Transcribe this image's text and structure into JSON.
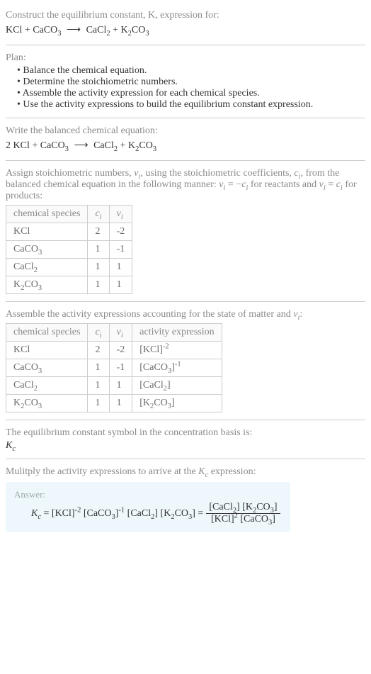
{
  "header": {
    "prompt": "Construct the equilibrium constant, K, expression for:",
    "equation_html": "KCl + CaCO<sub>3</sub> <span class='arrow'>⟶</span> CaCl<sub>2</sub> + K<sub>2</sub>CO<sub>3</sub>"
  },
  "plan": {
    "label": "Plan:",
    "items": [
      "Balance the chemical equation.",
      "Determine the stoichiometric numbers.",
      "Assemble the activity expression for each chemical species.",
      "Use the activity expressions to build the equilibrium constant expression."
    ]
  },
  "balanced": {
    "prompt": "Write the balanced chemical equation:",
    "equation_html": "2 KCl + CaCO<sub>3</sub> <span class='arrow'>⟶</span> CaCl<sub>2</sub> + K<sub>2</sub>CO<sub>3</sub>"
  },
  "stoich": {
    "intro_html": "Assign stoichiometric numbers, <span class='italic'>ν<sub>i</sub></span>, using the stoichiometric coefficients, <span class='italic'>c<sub>i</sub></span>, from the balanced chemical equation in the following manner: <span class='italic'>ν<sub>i</sub></span> = −<span class='italic'>c<sub>i</sub></span> for reactants and <span class='italic'>ν<sub>i</sub></span> = <span class='italic'>c<sub>i</sub></span> for products:",
    "headers": {
      "species": "chemical species",
      "ci_html": "<span class='italic'>c<sub>i</sub></span>",
      "vi_html": "<span class='italic'>ν<sub>i</sub></span>"
    },
    "rows": [
      {
        "species_html": "KCl",
        "ci": "2",
        "vi": "-2"
      },
      {
        "species_html": "CaCO<sub>3</sub>",
        "ci": "1",
        "vi": "-1"
      },
      {
        "species_html": "CaCl<sub>2</sub>",
        "ci": "1",
        "vi": "1"
      },
      {
        "species_html": "K<sub>2</sub>CO<sub>3</sub>",
        "ci": "1",
        "vi": "1"
      }
    ]
  },
  "activity": {
    "intro_html": "Assemble the activity expressions accounting for the state of matter and <span class='italic'>ν<sub>i</sub></span>:",
    "headers": {
      "species": "chemical species",
      "ci_html": "<span class='italic'>c<sub>i</sub></span>",
      "vi_html": "<span class='italic'>ν<sub>i</sub></span>",
      "activity": "activity expression"
    },
    "rows": [
      {
        "species_html": "KCl",
        "ci": "2",
        "vi": "-2",
        "activity_html": "[KCl]<sup>-2</sup>"
      },
      {
        "species_html": "CaCO<sub>3</sub>",
        "ci": "1",
        "vi": "-1",
        "activity_html": "[CaCO<sub>3</sub>]<sup>-1</sup>"
      },
      {
        "species_html": "CaCl<sub>2</sub>",
        "ci": "1",
        "vi": "1",
        "activity_html": "[CaCl<sub>2</sub>]"
      },
      {
        "species_html": "K<sub>2</sub>CO<sub>3</sub>",
        "ci": "1",
        "vi": "1",
        "activity_html": "[K<sub>2</sub>CO<sub>3</sub>]"
      }
    ]
  },
  "kc_symbol": {
    "line1": "The equilibrium constant symbol in the concentration basis is:",
    "line2_html": "<span class='italic'>K<sub>c</sub></span>"
  },
  "multiply": {
    "prompt_html": "Mulitply the activity expressions to arrive at the <span class='italic'>K<sub>c</sub></span> expression:"
  },
  "answer": {
    "label": "Answer:",
    "lhs_html": "<span class='italic'>K<sub>c</sub></span> = [KCl]<sup>-2</sup> [CaCO<sub>3</sub>]<sup>-1</sup> [CaCl<sub>2</sub>] [K<sub>2</sub>CO<sub>3</sub>] =",
    "frac_num_html": "[CaCl<sub>2</sub>] [K<sub>2</sub>CO<sub>3</sub>]",
    "frac_den_html": "[KCl]<sup>2</sup> [CaCO<sub>3</sub>]"
  }
}
